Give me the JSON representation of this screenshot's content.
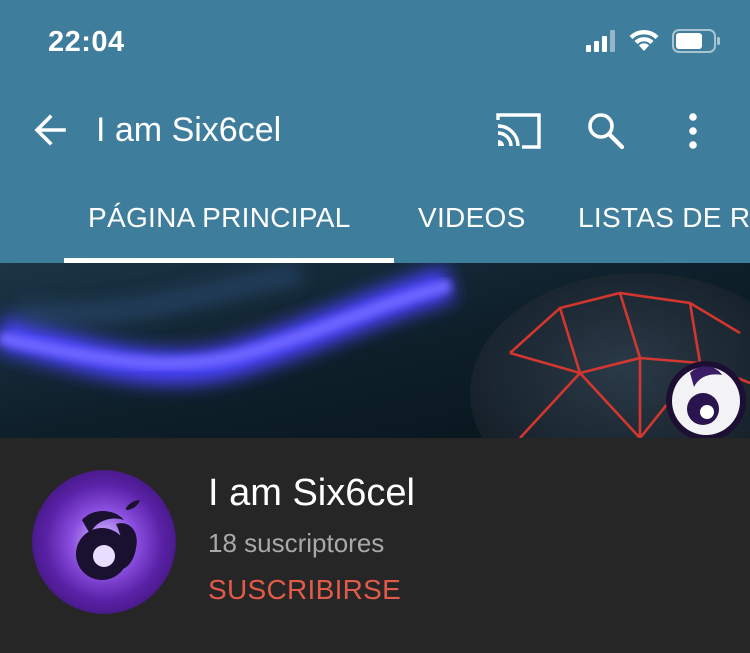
{
  "status_bar": {
    "time": "22:04",
    "icons": [
      "cellular-signal-icon",
      "wifi-icon",
      "battery-icon"
    ]
  },
  "app_bar": {
    "title": "I am Six6cel",
    "icons": [
      "back-arrow-icon",
      "cast-icon",
      "search-icon",
      "more-vert-icon"
    ]
  },
  "tabs": [
    {
      "label": "PÁGINA PRINCIPAL",
      "selected": true
    },
    {
      "label": "VIDEOS",
      "selected": false
    },
    {
      "label": "LISTAS DE R",
      "selected": false
    }
  ],
  "channel": {
    "name": "I am Six6cel",
    "subscribers": "18 suscriptores",
    "subscribe_label": "SUSCRIBIRSE"
  },
  "colors": {
    "app_bar": "#3f7d9c",
    "background": "#262626",
    "subscribe": "#e25a4a",
    "secondary_text": "#a9a9a9",
    "avatar_purple": "#6a2bb8"
  }
}
